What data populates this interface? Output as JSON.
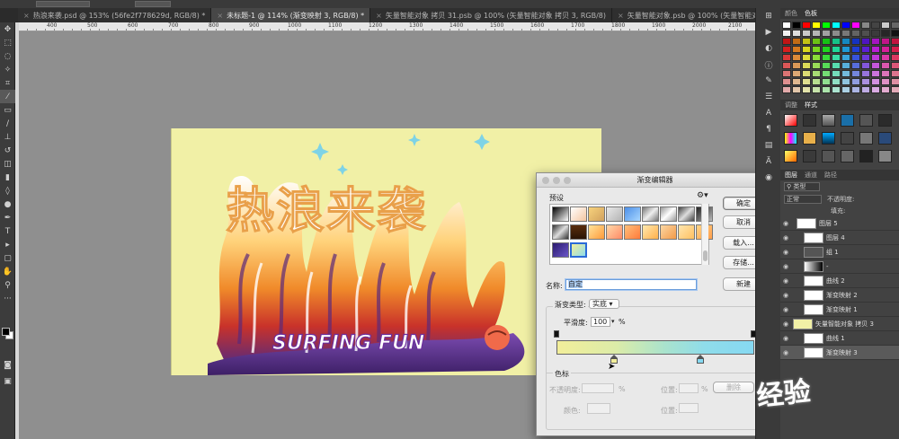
{
  "tabs": [
    {
      "label": "热浪来袭.psd @ 153% (56fe2f778629d, RGB/8) *",
      "active": false
    },
    {
      "label": "未标题-1 @ 114% (渐变映射 3, RGB/8) *",
      "active": true
    },
    {
      "label": "矢量智能对象 拷贝 31.psb @ 100% (矢量智能对象 拷贝 3, RGB/8)",
      "active": false
    },
    {
      "label": "矢量智能对象.psb @ 100% (矢量智能对象, RGB/8)",
      "active": false
    }
  ],
  "ruler_numbers": [
    "400",
    "500",
    "600",
    "700",
    "800",
    "900",
    "1000",
    "1100",
    "1200",
    "1300",
    "1400",
    "1500",
    "1600",
    "1700",
    "1800",
    "1900",
    "2000",
    "2100"
  ],
  "artwork": {
    "title_text": "热浪来袭",
    "subtitle_text": "SURFING FUN",
    "background": "#f1f0a6"
  },
  "dialog": {
    "title": "渐变编辑器",
    "presets_label": "预设",
    "buttons": {
      "ok": "确定",
      "cancel": "取消",
      "load": "载入...",
      "save": "存储...",
      "new": "新建"
    },
    "name_label": "名称:",
    "name_value": "自定",
    "gradient_type_label": "渐变类型:",
    "gradient_type_value": "实底",
    "smoothness_label": "平滑度:",
    "smoothness_value": "100",
    "smoothness_unit": "%",
    "stops_label": "色标",
    "opacity_label": "不透明度:",
    "opacity_unit": "%",
    "location_label": "位置:",
    "location_unit": "%",
    "delete_label": "删除",
    "color_label": "颜色:",
    "location_label_2": "位置:"
  },
  "panels": {
    "swatch_tabs": [
      "颜色",
      "色板"
    ],
    "adjust_tabs": [
      "调整",
      "样式"
    ],
    "layer_tabs": [
      "图层",
      "通道",
      "路径"
    ],
    "filter_kind": "类型",
    "blend_mode": "正常",
    "opacity_label": "不透明度:",
    "fill_label": "填充:",
    "layers": [
      {
        "name": "图层 5",
        "selected": false
      },
      {
        "name": "图层 4",
        "selected": false
      },
      {
        "name": "组 1",
        "selected": false
      },
      {
        "name": "-",
        "selected": false
      },
      {
        "name": "曲线 2",
        "selected": false
      },
      {
        "name": "渐变映射 2",
        "selected": false
      },
      {
        "name": "渐变映射 1",
        "selected": false
      },
      {
        "name": "矢量智能对象 拷贝 3",
        "selected": false
      },
      {
        "name": "曲线 1",
        "selected": false
      },
      {
        "name": "渐变映射 3",
        "selected": true
      }
    ]
  },
  "watermark": "经验"
}
